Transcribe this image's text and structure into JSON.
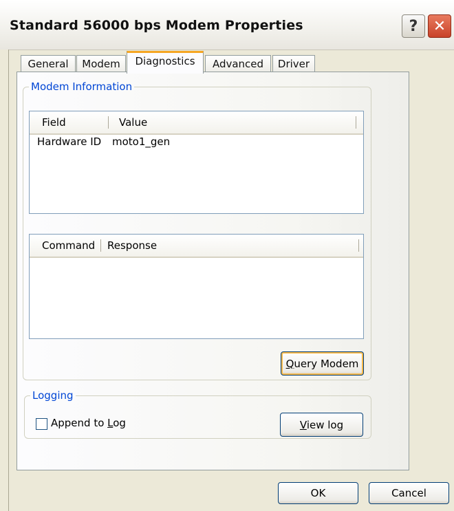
{
  "window": {
    "title": "Standard 56000 bps Modem Properties",
    "help_label": "?",
    "close_label": "✕"
  },
  "tabs": [
    {
      "label": "General"
    },
    {
      "label": "Modem"
    },
    {
      "label": "Diagnostics"
    },
    {
      "label": "Advanced"
    },
    {
      "label": "Driver"
    }
  ],
  "modem_info": {
    "legend": "Modem Information",
    "info_table": {
      "headers": [
        "Field",
        "Value"
      ],
      "rows": [
        [
          "Hardware ID",
          "moto1_gen"
        ]
      ]
    },
    "command_table": {
      "headers": [
        "Command",
        "Response"
      ]
    },
    "query_button": {
      "pre": "",
      "ul": "Q",
      "post": "uery Modem"
    }
  },
  "logging": {
    "legend": "Logging",
    "append_checkbox": {
      "checked": false,
      "pre": "Append to ",
      "ul": "L",
      "post": "og"
    },
    "view_log_button": {
      "pre": "",
      "ul": "V",
      "post": "iew log"
    }
  },
  "footer": {
    "ok_label": "OK",
    "cancel_label": "Cancel"
  }
}
